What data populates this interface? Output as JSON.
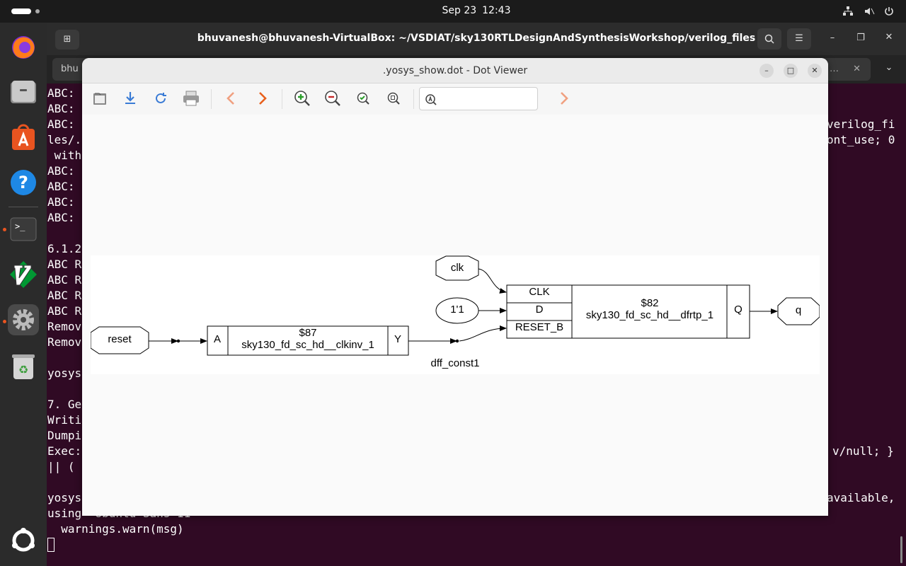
{
  "topbar": {
    "date": "Sep 23",
    "time": "12:43"
  },
  "terminal": {
    "title": "bhuvanesh@bhuvanesh-VirtualBox: ~/VSDIAT/sky130RTLDesignAndSynthesisWorkshop/verilog_files",
    "tab_label": "bhu",
    "lines": [
      "ABC:",
      "ABC:",
      "ABC:",
      "les/.",
      " with",
      "ABC:",
      "ABC:",
      "ABC:",
      "ABC:",
      "6.1.2",
      "ABC R",
      "ABC R",
      "ABC R",
      "ABC R",
      "Remov",
      "Remov",
      "yosys",
      "7. Ge",
      "Writi",
      "Dumpi",
      "Exec:",
      "|| (",
      "yosys",
      "using  Ubuntu Sans 11",
      "  warnings.warn(msg)"
    ],
    "right_lines": [
      "verilog_fi",
      "ont_use; 0",
      "v/null; }",
      "available,"
    ]
  },
  "dotviewer": {
    "title": ".yosys_show.dot - Dot Viewer",
    "search_value": "",
    "graph": {
      "reset_port": "reset",
      "clk_port": "clk",
      "const_node": "1'1",
      "q_port": "q",
      "inv_cell": {
        "in_pin": "A",
        "id": "$87",
        "type": "sky130_fd_sc_hd__clkinv_1",
        "out_pin": "Y"
      },
      "dff_cell": {
        "pin_clk": "CLK",
        "pin_d": "D",
        "pin_reset": "RESET_B",
        "id": "$82",
        "type": "sky130_fd_sc_hd__dfrtp_1",
        "out_pin": "Q"
      },
      "wire_label": "dff_const1"
    }
  },
  "colors": {
    "terminal_bg": "#300a24",
    "accent": "#e95420"
  }
}
